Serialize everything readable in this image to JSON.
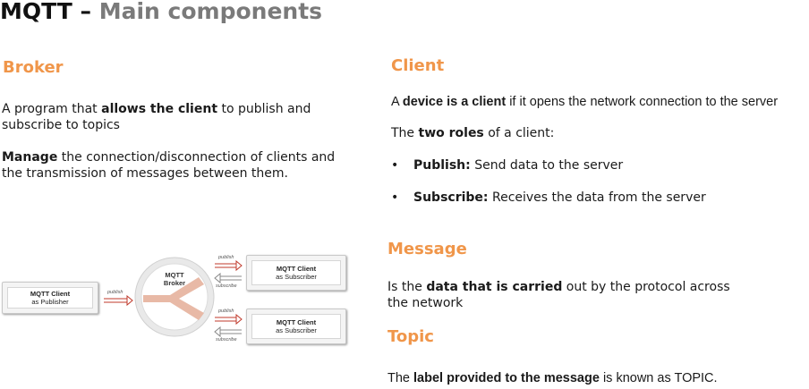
{
  "title": {
    "main": "MQTT",
    "dash": " – ",
    "sub": "Main components"
  },
  "broker": {
    "heading": "Broker",
    "p1": {
      "before": "A program that ",
      "bold": "allows the client",
      "after": " to publish and subscribe to topics"
    },
    "p2": {
      "bold": "Manage",
      "after": " the connection/disconnection of clients and the transmission of messages between them."
    }
  },
  "client": {
    "heading": "Client",
    "p1": {
      "before": "A ",
      "bold": "device is a client",
      "after": " if it opens the network connection to the server"
    },
    "p2": {
      "before": "The ",
      "bold": "two roles",
      "after": " of a client:"
    },
    "bullets": [
      {
        "bold": "Publish:",
        "text": " Send data to the server"
      },
      {
        "bold": "Subscribe:",
        "text": " Receives the data from the server"
      }
    ],
    "bullet_char": "•"
  },
  "message": {
    "heading": "Message",
    "p1": {
      "before": "Is the ",
      "bold": "data that is carried",
      "after": " out by the protocol across the network"
    }
  },
  "topic": {
    "heading": "Topic",
    "p1": {
      "before": "The ",
      "bold": "label provided to the message",
      "after": " is known as TOPIC."
    }
  },
  "diagram": {
    "publisher": {
      "line1": "MQTT Client",
      "line2": "as Publisher"
    },
    "broker": {
      "line1": "MQTT",
      "line2": "Broker"
    },
    "subscriber1": {
      "line1": "MQTT Client",
      "line2": "as Subscriber"
    },
    "subscriber2": {
      "line1": "MQTT Client",
      "line2": "as Subscriber"
    },
    "labels": {
      "publish": "publish",
      "subscribe": "subscribe"
    },
    "colors": {
      "arrow": "#c0392b",
      "flow": "#e8b9a6",
      "ring": "#cfcfcf"
    }
  }
}
